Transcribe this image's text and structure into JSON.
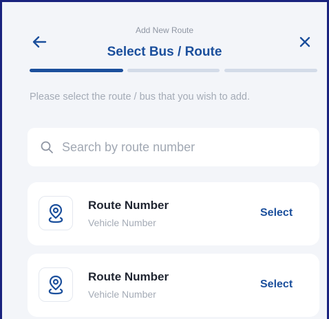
{
  "header": {
    "subtitle": "Add New Route",
    "title": "Select Bus / Route"
  },
  "progress": {
    "total_steps": 3,
    "current_step": 1
  },
  "instruction": "Please select the route / bus that you wish to add.",
  "search": {
    "placeholder": "Search by route number",
    "value": ""
  },
  "routes": [
    {
      "route_label": "Route Number",
      "vehicle_label": "Vehicle Number",
      "action_label": "Select"
    },
    {
      "route_label": "Route Number",
      "vehicle_label": "Vehicle Number",
      "action_label": "Select"
    }
  ],
  "icons": {
    "back": "arrow-left-icon",
    "close": "close-icon",
    "search": "search-icon",
    "route": "location-pin-icon"
  },
  "colors": {
    "accent": "#1b4f9c",
    "background": "#f3f5f9",
    "inactive": "#d3dbe8",
    "muted_text": "#a4abb6"
  }
}
